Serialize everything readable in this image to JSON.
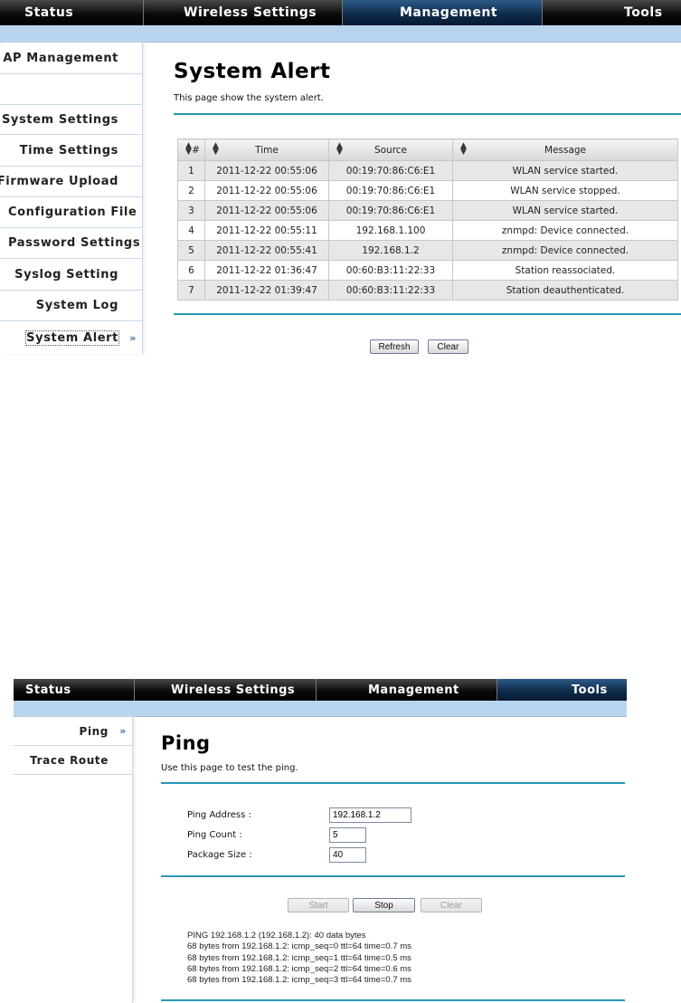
{
  "screen1": {
    "nav": [
      "Status",
      "Wireless Settings",
      "Management",
      "Tools"
    ],
    "active_tab": "Management",
    "sidebar": [
      {
        "label": "AP Management"
      },
      {
        "label": "System Settings"
      },
      {
        "label": "Time Settings"
      },
      {
        "label": "Firmware Upload"
      },
      {
        "label": "Configuration File"
      },
      {
        "label": "Password Settings"
      },
      {
        "label": "Syslog Setting"
      },
      {
        "label": "System Log"
      },
      {
        "label": "System Alert",
        "current": true
      }
    ],
    "title": "System Alert",
    "description": "This page show the system alert.",
    "table": {
      "headers": [
        "#",
        "Time",
        "Source",
        "Message"
      ],
      "rows": [
        [
          "1",
          "2011-12-22 00:55:06",
          "00:19:70:86:C6:E1",
          "WLAN service started."
        ],
        [
          "2",
          "2011-12-22 00:55:06",
          "00:19:70:86:C6:E1",
          "WLAN service stopped."
        ],
        [
          "3",
          "2011-12-22 00:55:06",
          "00:19:70:86:C6:E1",
          "WLAN service started."
        ],
        [
          "4",
          "2011-12-22 00:55:11",
          "192.168.1.100",
          "znmpd: Device connected."
        ],
        [
          "5",
          "2011-12-22 00:55:41",
          "192.168.1.2",
          "znmpd: Device connected."
        ],
        [
          "6",
          "2011-12-22 01:36:47",
          "00:60:B3:11:22:33",
          "Station reassociated."
        ],
        [
          "7",
          "2011-12-22 01:39:47",
          "00:60:B3:11:22:33",
          "Station deauthenticated."
        ]
      ]
    },
    "buttons": {
      "refresh": "Refresh",
      "clear": "Clear"
    }
  },
  "screen2": {
    "nav": [
      "Status",
      "Wireless Settings",
      "Management",
      "Tools"
    ],
    "active_tab": "Tools",
    "sidebar": [
      {
        "label": "Ping",
        "current": true
      },
      {
        "label": "Trace Route"
      }
    ],
    "title": "Ping",
    "description": "Use this page to test the ping.",
    "fields": {
      "address": {
        "label": "Ping Address :",
        "value": "192.168.1.2"
      },
      "count": {
        "label": "Ping Count :",
        "value": "5"
      },
      "size": {
        "label": "Package Size :",
        "value": "40"
      }
    },
    "buttons": {
      "start": "Start",
      "stop": "Stop",
      "clear": "Clear"
    },
    "output": [
      "PING 192.168.1.2 (192.168.1.2): 40 data bytes",
      "68 bytes from 192.168.1.2: icmp_seq=0 ttl=64 time=0.7 ms",
      "68 bytes from 192.168.1.2: icmp_seq=1 ttl=64 time=0.5 ms",
      "68 bytes from 192.168.1.2: icmp_seq=2 ttl=64 time=0.6 ms",
      "68 bytes from 192.168.1.2: icmp_seq=3 ttl=64 time=0.7 ms"
    ]
  },
  "colors": {
    "nav_bg": "#000000",
    "active_tab": "#0f2c4c",
    "subbar": "#b9d4ef",
    "divider": "#2a96b8"
  }
}
